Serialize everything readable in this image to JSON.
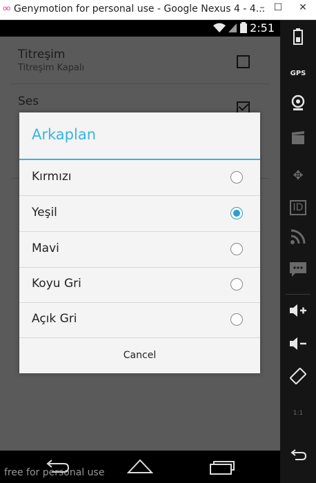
{
  "window": {
    "title": "Genymotion for personal use - Google Nexus 4 - 4...",
    "minimize": "–",
    "maximize": "☐",
    "close": "✕"
  },
  "statusbar": {
    "time": "2:51"
  },
  "settings": [
    {
      "title": "Titreşim",
      "subtitle": "Titreşim Kapalı",
      "checked": false
    },
    {
      "title": "Ses",
      "subtitle": "",
      "checked": true
    }
  ],
  "dialog": {
    "title": "Arkaplan",
    "options": [
      {
        "label": "Kırmızı",
        "selected": false
      },
      {
        "label": "Yeşil",
        "selected": true
      },
      {
        "label": "Mavi",
        "selected": false
      },
      {
        "label": "Koyu Gri",
        "selected": false
      },
      {
        "label": "Açık Gri",
        "selected": false
      }
    ],
    "cancel_label": "Cancel"
  },
  "watermark": "free for personal use",
  "toolbar": {
    "gps_label": "GPS",
    "id_label": "ID",
    "ratio_label": "1:1"
  },
  "colors": {
    "accent": "#33b5e5",
    "radio": "#2a9fd0"
  }
}
